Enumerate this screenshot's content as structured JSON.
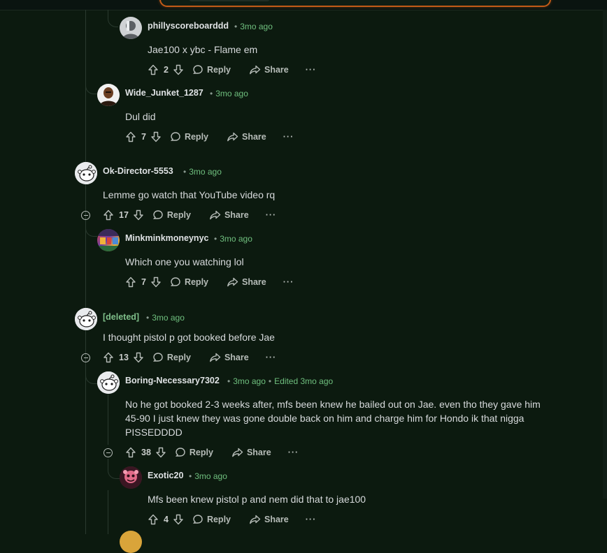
{
  "ui": {
    "reply_label": "Reply",
    "share_label": "Share",
    "more_label": "···",
    "separator": "•"
  },
  "comments": [
    {
      "author": "phillyscoreboarddd",
      "time": "3mo ago",
      "text": "Jae100 x ybc - Flame em",
      "votes": "2",
      "avatar": "gray-avatar"
    },
    {
      "author": "Wide_Junket_1287",
      "time": "3mo ago",
      "text": "Dul did",
      "votes": "7",
      "avatar": "dark-avatar"
    },
    {
      "author": "Ok-Director-5553",
      "time": "3mo ago",
      "text": "Lemme go watch that YouTube video rq",
      "votes": "17",
      "avatar": "snoo-avatar"
    },
    {
      "author": "Minkminkmoneynyc",
      "time": "3mo ago",
      "text": "Which one you watching lol",
      "votes": "7",
      "avatar": "multicolor-avatar"
    },
    {
      "author": "[deleted]",
      "time": "3mo ago",
      "text": "I thought pistol p got booked before Jae",
      "votes": "13",
      "avatar": "snoo-avatar"
    },
    {
      "author": "Boring-Necessary7302",
      "time": "3mo ago",
      "edited": "Edited 3mo ago",
      "text_lines": [
        "No he got booked 2-3 weeks after, mfs been knew he bailed out on Jae. even tho they gave him",
        "45-90 I just knew they was gone double back on him and charge him for Hondo ik that nigga",
        "PISSEDDDD"
      ],
      "votes": "38",
      "avatar": "snoo-avatar"
    },
    {
      "author": "Exotic20",
      "time": "3mo ago",
      "text": "Mfs been knew pistol p and nem did that to jae100",
      "votes": "4",
      "avatar": "pink-avatar"
    }
  ],
  "colors": {
    "background": "#0c1a0f",
    "timestamp": "#6fbf7e",
    "thread_line": "#2a3a2f",
    "search_border": "#c25a17"
  }
}
